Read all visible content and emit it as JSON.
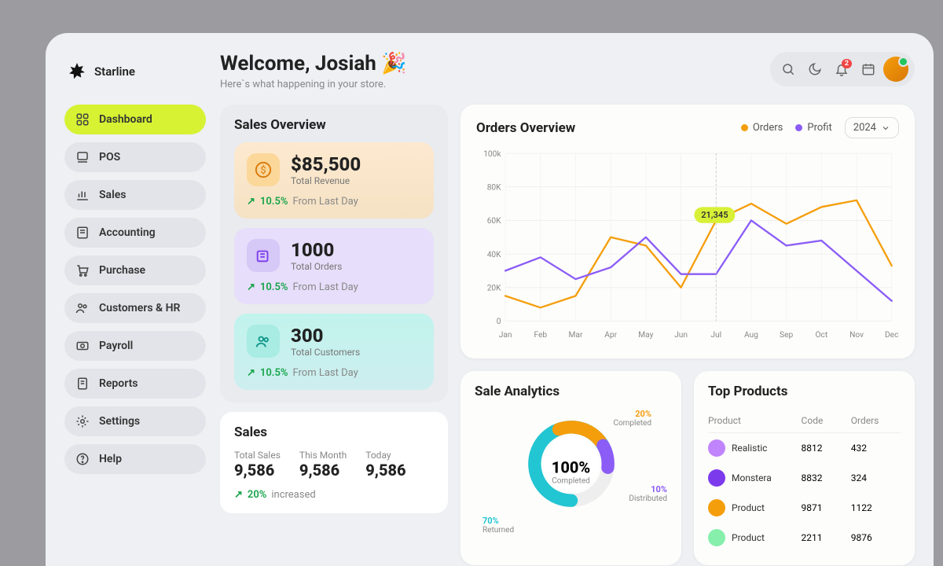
{
  "brand": {
    "name": "Starline"
  },
  "header": {
    "welcome_title": "Welcome, Josiah 🎉",
    "welcome_sub": "Here`s what happening in your store.",
    "notification_count": "2"
  },
  "sidebar": {
    "items": [
      {
        "id": "dashboard",
        "label": "Dashboard",
        "active": true
      },
      {
        "id": "pos",
        "label": "POS"
      },
      {
        "id": "sales",
        "label": " Sales"
      },
      {
        "id": "accounting",
        "label": "Accounting"
      },
      {
        "id": "purchase",
        "label": "Purchase"
      },
      {
        "id": "customers-hr",
        "label": "Customers & HR"
      },
      {
        "id": "payroll",
        "label": "Payroll"
      },
      {
        "id": "reports",
        "label": "Reports"
      },
      {
        "id": "settings",
        "label": "Settings"
      },
      {
        "id": "help",
        "label": " Help"
      }
    ]
  },
  "sales_overview": {
    "title": "Sales Overview",
    "revenue": {
      "value": "$85,500",
      "label": "Total Revenue",
      "delta": "10.5%",
      "note": "From Last Day"
    },
    "orders": {
      "value": "1000",
      "label": "Total Orders",
      "delta": "10.5%",
      "note": "From Last Day"
    },
    "customers": {
      "value": "300",
      "label": "Total Customers",
      "delta": "10.5%",
      "note": "From Last Day"
    }
  },
  "sales_box": {
    "title": "Sales",
    "metrics": [
      {
        "label": "Total Sales",
        "value": "9,586"
      },
      {
        "label": "This Month",
        "value": "9,586"
      },
      {
        "label": "Today",
        "value": "9,586"
      }
    ],
    "delta": "20%",
    "delta_note": "increased"
  },
  "orders_overview": {
    "title": "Orders Overview",
    "legend": {
      "orders": "Orders",
      "profit": "Profit"
    },
    "year": "2024",
    "tooltip": "21,345"
  },
  "sale_analytics": {
    "title": "Sale Analytics",
    "center_value": "100%",
    "center_label": "Completed",
    "segments": {
      "completed": {
        "pct": "20%",
        "label": "Completed"
      },
      "distributed": {
        "pct": "10%",
        "label": "Distributed"
      },
      "returned": {
        "pct": "70%",
        "label": "Returned"
      }
    }
  },
  "top_products": {
    "title": "Top Products",
    "columns": {
      "product": "Product",
      "code": "Code",
      "orders": "Orders"
    },
    "rows": [
      {
        "name": "Realistic",
        "code": "8812",
        "orders": "432",
        "color": "#c084fc"
      },
      {
        "name": "Monstera",
        "code": "8832",
        "orders": "324",
        "color": "#7c3aed"
      },
      {
        "name": "Product",
        "code": "9871",
        "orders": "1122",
        "color": "#f59e0b"
      },
      {
        "name": "Product",
        "code": "2211",
        "orders": "9876",
        "color": "#86efac"
      }
    ]
  },
  "chart_data": {
    "type": "line",
    "title": "Orders Overview",
    "xlabel": "",
    "ylabel": "",
    "categories": [
      "Jan",
      "Feb",
      "Mar",
      "Apr",
      "May",
      "Jun",
      "Jul",
      "Aug",
      "Sep",
      "Oct",
      "Nov",
      "Dec"
    ],
    "y_ticks": [
      "0",
      "20K",
      "40K",
      "60K",
      "80K",
      "100k"
    ],
    "ylim": [
      0,
      100000
    ],
    "series": [
      {
        "name": "Orders",
        "color": "#f59e0b",
        "values": [
          15000,
          8000,
          15000,
          50000,
          45000,
          20000,
          60000,
          70000,
          58000,
          68000,
          72000,
          33000
        ]
      },
      {
        "name": "Profit",
        "color": "#8b5cf6",
        "values": [
          30000,
          38000,
          25000,
          32000,
          50000,
          28000,
          28000,
          60000,
          45000,
          48000,
          30000,
          12000
        ]
      }
    ],
    "tooltip": {
      "x_index": 6,
      "value": 21345
    }
  }
}
